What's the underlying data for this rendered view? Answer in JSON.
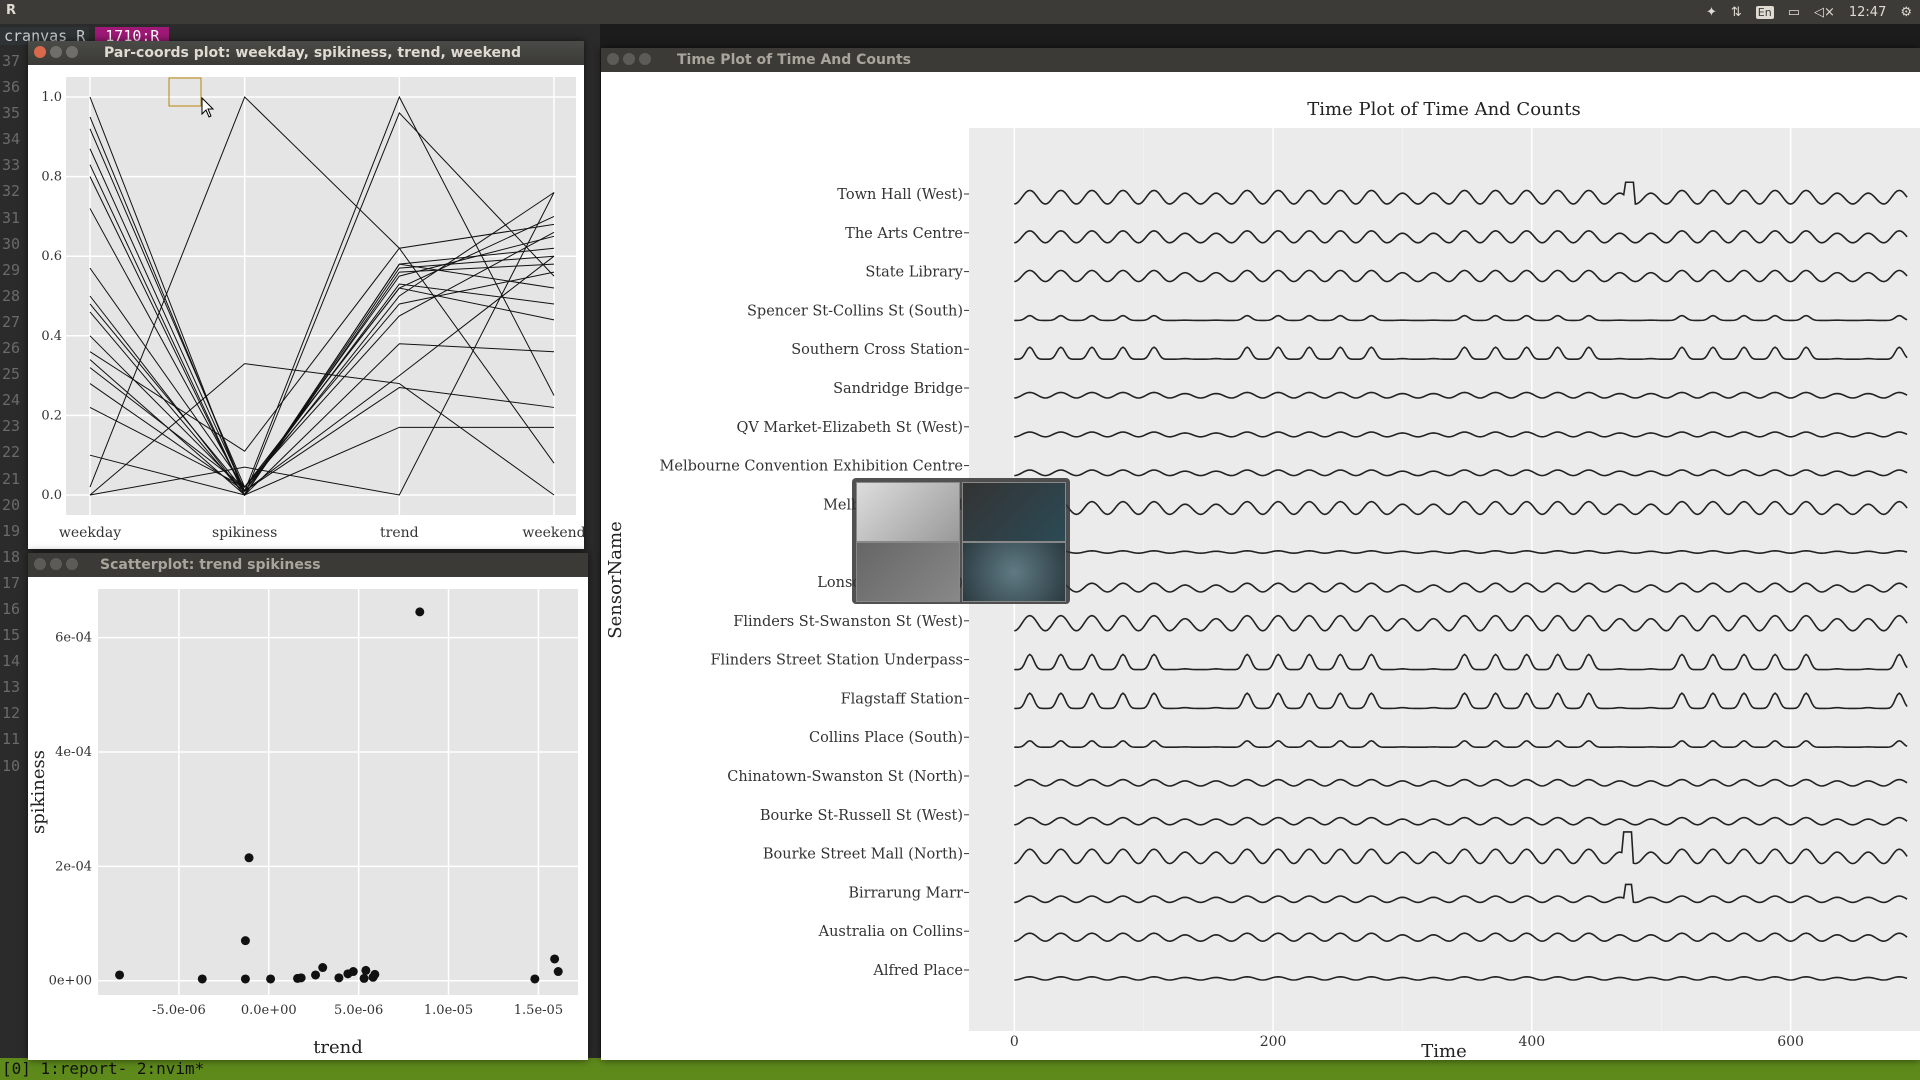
{
  "system": {
    "app_name": "R",
    "clock": "12:47",
    "keyboard": "En",
    "icons": [
      "dropbox-icon",
      "network-arrows-icon",
      "keyboard-layout-icon",
      "battery-icon",
      "volume-muted-icon",
      "settings-gear-icon"
    ]
  },
  "terminal": {
    "tab1": "cranvas R",
    "tab2": "1710:R",
    "line_numbers": [
      "37",
      "36",
      "35",
      "34",
      "33",
      "32",
      "31",
      "30",
      "29",
      "28",
      "27",
      "26",
      "25",
      "24",
      "23",
      "22",
      "21",
      "20",
      "19",
      "18",
      "17",
      "16",
      "15",
      "14",
      "13",
      "12",
      "11",
      "10"
    ],
    "status_left": "[0] 1:report- 2:nvim*",
    "status_right": ""
  },
  "parcoords": {
    "window_title": "Par-coords plot: weekday, spikiness, trend, weekend",
    "chart_data": {
      "type": "line",
      "categories": [
        "weekday",
        "spikiness",
        "trend",
        "weekend"
      ],
      "ylim": [
        0,
        1
      ],
      "yticks": [
        "0.0",
        "0.2",
        "0.4",
        "0.6",
        "0.8",
        "1.0"
      ],
      "series": [
        {
          "values": [
            1.0,
            0.0,
            0.58,
            0.62
          ]
        },
        {
          "values": [
            0.95,
            0.01,
            0.55,
            0.65
          ]
        },
        {
          "values": [
            0.92,
            0.02,
            0.52,
            0.7
          ]
        },
        {
          "values": [
            0.87,
            0.01,
            0.5,
            0.76
          ]
        },
        {
          "values": [
            0.83,
            0.0,
            0.57,
            0.6
          ]
        },
        {
          "values": [
            0.8,
            0.0,
            0.96,
            0.55
          ]
        },
        {
          "values": [
            0.72,
            0.01,
            1.0,
            0.25
          ]
        },
        {
          "values": [
            0.57,
            0.02,
            0.45,
            0.66
          ]
        },
        {
          "values": [
            0.5,
            0.0,
            0.56,
            0.58
          ]
        },
        {
          "values": [
            0.48,
            0.01,
            0.53,
            0.48
          ]
        },
        {
          "values": [
            0.46,
            0.0,
            0.38,
            0.36
          ]
        },
        {
          "values": [
            0.4,
            0.01,
            0.27,
            0.22
          ]
        },
        {
          "values": [
            0.34,
            0.0,
            0.58,
            0.52
          ]
        },
        {
          "values": [
            0.32,
            0.02,
            0.52,
            0.44
          ]
        },
        {
          "values": [
            0.28,
            0.01,
            0.3,
            0.6
          ]
        },
        {
          "values": [
            0.22,
            0.02,
            0.48,
            0.56
          ]
        },
        {
          "values": [
            0.1,
            0.0,
            0.17,
            0.17
          ]
        },
        {
          "values": [
            0.0,
            0.33,
            0.28,
            0.0
          ]
        },
        {
          "values": [
            0.02,
            1.0,
            0.62,
            0.08
          ]
        },
        {
          "values": [
            0.0,
            0.07,
            0.0,
            0.76
          ]
        },
        {
          "values": [
            0.36,
            0.11,
            0.62,
            0.68
          ]
        }
      ]
    }
  },
  "scatter": {
    "window_title": "Scatterplot: trend spikiness",
    "chart_data": {
      "type": "scatter",
      "xlabel": "trend",
      "ylabel": "spikiness",
      "xlim": [
        -9.5e-06,
        1.72e-05
      ],
      "ylim": [
        -2.5e-05,
        0.000685
      ],
      "xticks": [
        {
          "v": -5e-06,
          "label": "-5.0e-06"
        },
        {
          "v": 0,
          "label": "0.0e+00"
        },
        {
          "v": 5e-06,
          "label": "5.0e-06"
        },
        {
          "v": 1e-05,
          "label": "1.0e-05"
        },
        {
          "v": 1.5e-05,
          "label": "1.5e-05"
        }
      ],
      "yticks": [
        {
          "v": 0,
          "label": "0e+00"
        },
        {
          "v": 0.0002,
          "label": "2e-04"
        },
        {
          "v": 0.0004,
          "label": "4e-04"
        },
        {
          "v": 0.0006,
          "label": "6e-04"
        }
      ],
      "points": [
        {
          "x": -8.3e-06,
          "y": 1e-05
        },
        {
          "x": -3.7e-06,
          "y": 3e-06
        },
        {
          "x": -1.3e-06,
          "y": 3e-06
        },
        {
          "x": -1.3e-06,
          "y": 7e-05
        },
        {
          "x": -1.1e-06,
          "y": 0.000215
        },
        {
          "x": 1e-07,
          "y": 3e-06
        },
        {
          "x": 1.6e-06,
          "y": 4e-06
        },
        {
          "x": 1.8e-06,
          "y": 5e-06
        },
        {
          "x": 2.6e-06,
          "y": 1e-05
        },
        {
          "x": 3e-06,
          "y": 2.3e-05
        },
        {
          "x": 3.9e-06,
          "y": 5e-06
        },
        {
          "x": 4.4e-06,
          "y": 1.2e-05
        },
        {
          "x": 4.7e-06,
          "y": 1.6e-05
        },
        {
          "x": 5.3e-06,
          "y": 4e-06
        },
        {
          "x": 5.4e-06,
          "y": 1.8e-05
        },
        {
          "x": 5.8e-06,
          "y": 6e-06
        },
        {
          "x": 5.9e-06,
          "y": 1.1e-05
        },
        {
          "x": 8.4e-06,
          "y": 0.000645
        },
        {
          "x": 1.48e-05,
          "y": 3e-06
        },
        {
          "x": 1.59e-05,
          "y": 3.8e-05
        },
        {
          "x": 1.61e-05,
          "y": 1.6e-05
        }
      ]
    }
  },
  "timeplot": {
    "window_title": "Time Plot of Time And Counts",
    "chart_data": {
      "type": "line",
      "title": "Time Plot of Time And Counts",
      "xlabel": "Time",
      "ylabel": "SensorName",
      "xlim": [
        -35,
        700
      ],
      "xticks": [
        "0",
        "200",
        "400",
        "600"
      ],
      "sensors": [
        "Town Hall (West)",
        "The Arts Centre",
        "State Library",
        "Spencer St-Collins St (South)",
        "Southern Cross Station",
        "Sandridge Bridge",
        "QV Market-Elizabeth St (West)",
        "Melbourne Convention Exhibition Centre",
        "Melbourne Central",
        "",
        "Lonsdale St (South)",
        "Flinders St-Swanston St (West)",
        "Flinders Street Station Underpass",
        "Flagstaff Station",
        "Collins Place (South)",
        "Chinatown-Swanston St (North)",
        "Bourke St-Russell St (West)",
        "Bourke Street Mall (North)",
        "Birrarung Marr",
        "Australia on Collins",
        "Alfred Place"
      ],
      "amplitudes": [
        0.85,
        0.75,
        0.7,
        0.3,
        0.75,
        0.35,
        0.3,
        0.35,
        0.8,
        0.15,
        0.55,
        0.95,
        0.95,
        0.95,
        0.4,
        0.4,
        0.45,
        0.9,
        0.4,
        0.5,
        0.2
      ],
      "spike_types": [
        "daily",
        "daily",
        "daily",
        "weekday",
        "weekday",
        "daily",
        "daily",
        "daily",
        "daily",
        "daily",
        "daily",
        "daily",
        "weekday",
        "weekday",
        "weekday",
        "daily",
        "daily",
        "daily",
        "daily",
        "daily",
        "daily"
      ]
    }
  },
  "switcher": {
    "thumbnails": [
      "thumbnail-window-1",
      "thumbnail-window-2",
      "thumbnail-window-3",
      "thumbnail-window-4"
    ]
  }
}
